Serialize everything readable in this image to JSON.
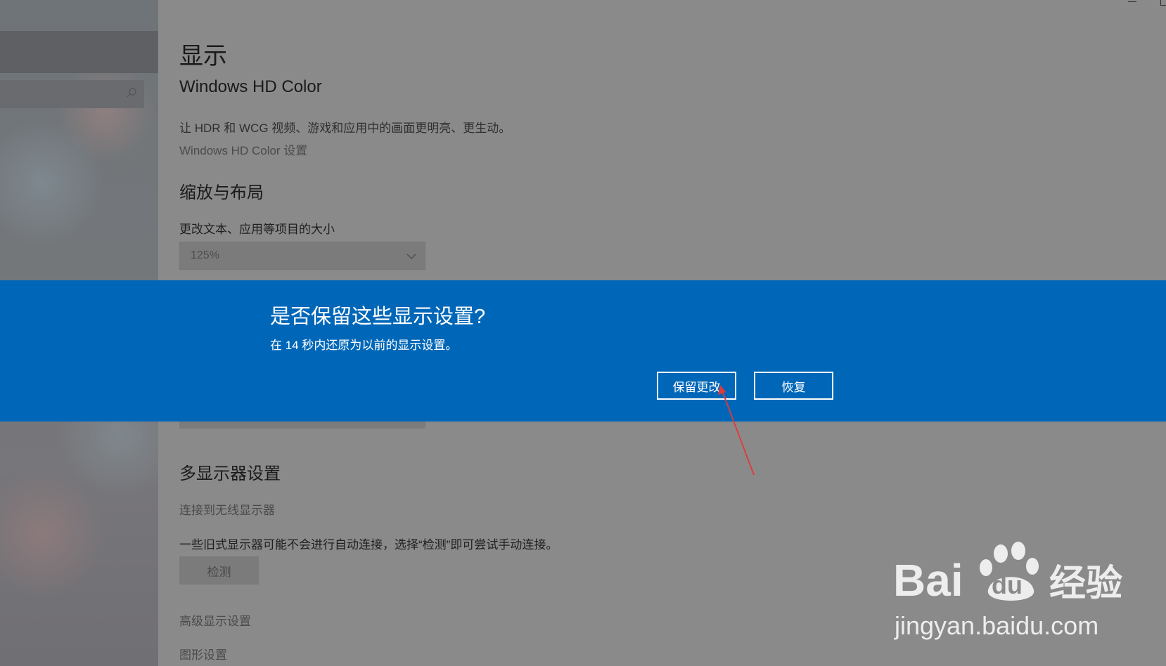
{
  "sidebar": {
    "search_icon": "search-icon"
  },
  "window": {
    "minimize_icon": "minimize-icon",
    "maximize_icon": "maximize-icon"
  },
  "page": {
    "title": "显示"
  },
  "hd_color": {
    "title": "Windows HD Color",
    "description": "让 HDR 和 WCG 视频、游戏和应用中的画面更明亮、更生动。",
    "settings_link": "Windows HD Color 设置"
  },
  "scale_layout": {
    "title": "缩放与布局",
    "size_label": "更改文本、应用等项目的大小",
    "size_value": "125%"
  },
  "multi_display": {
    "title": "多显示器设置",
    "wireless_link": "连接到无线显示器",
    "legacy_description": "一些旧式显示器可能不会进行自动连接，选择“检测”即可尝试手动连接。",
    "detect_label": "检测",
    "advanced_link": "高级显示设置",
    "graphics_link": "图形设置"
  },
  "banner": {
    "title": "是否保留这些显示设置?",
    "description": "在 14 秒内还原为以前的显示设置。",
    "keep_label": "保留更改",
    "revert_label": "恢复"
  },
  "annotation": {
    "arrow_color": "#e03a3a"
  },
  "watermark": {
    "brand": "Bai经验",
    "url": "jingyan.baidu.com"
  },
  "colors": {
    "banner_blue": "#0067b8",
    "overlay_gray": "#8a8a8a"
  }
}
